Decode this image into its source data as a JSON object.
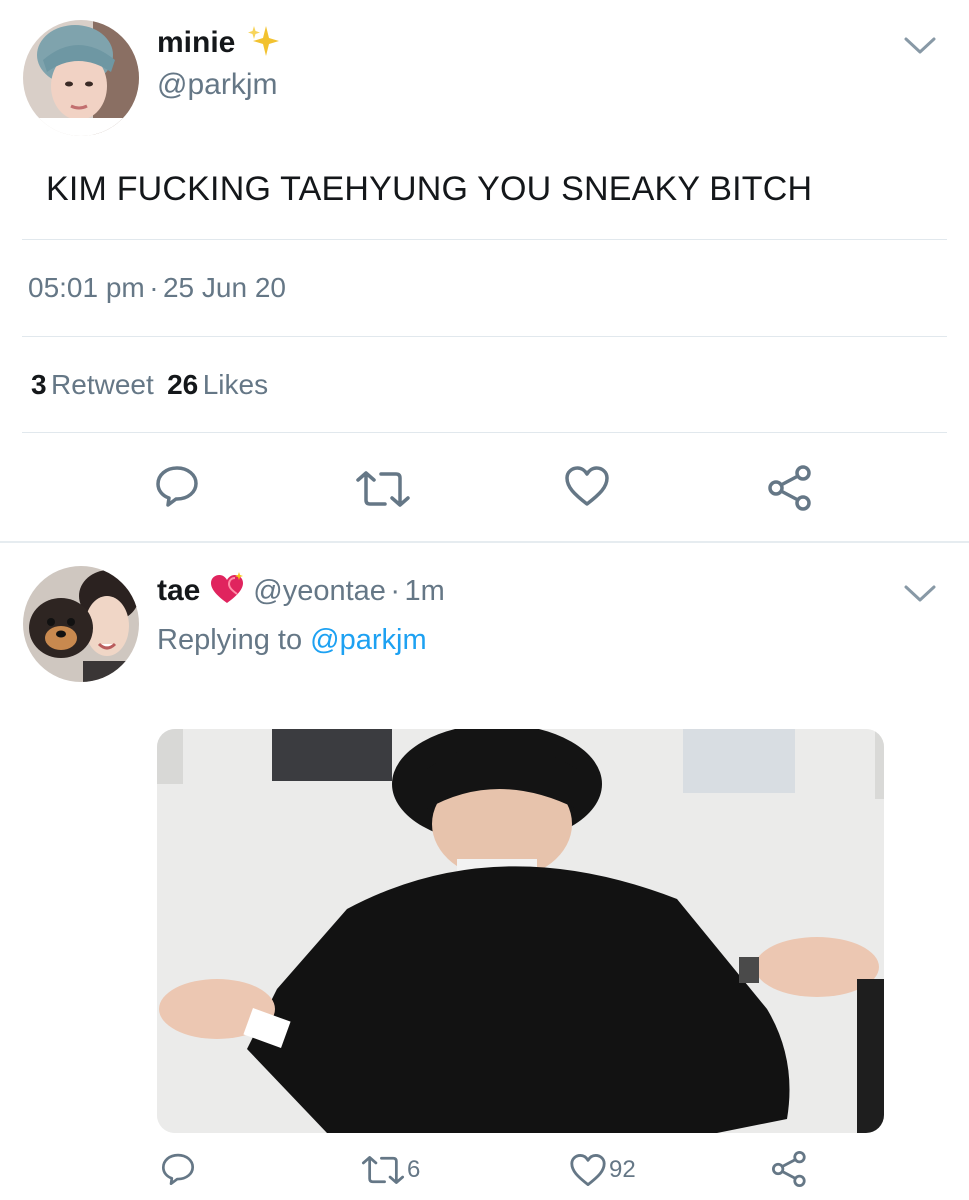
{
  "main_tweet": {
    "display_name": "minie",
    "handle": "@parkjm",
    "text": "KIM FUCKING TAEHYUNG YOU SNEAKY BITCH",
    "time": "05:01 pm",
    "separator": "·",
    "date": "25 Jun 20",
    "retweet_count": "3",
    "retweet_label": "Retweet",
    "likes_count": "26",
    "likes_label": "Likes",
    "icons": [
      "sparkle-icon",
      "chevron-down-icon",
      "reply-icon",
      "retweet-icon",
      "like-icon",
      "share-icon"
    ]
  },
  "reply_tweet": {
    "display_name": "tae",
    "handle": "@yeontae",
    "separator": "·",
    "age": "1m",
    "replying_prefix": "Replying to",
    "replying_to": "@parkjm",
    "retweet_count": "6",
    "like_count": "92",
    "icons": [
      "sparkling-heart-icon",
      "chevron-down-icon",
      "reply-icon",
      "retweet-icon",
      "like-icon",
      "share-icon"
    ]
  },
  "colors": {
    "text_primary": "#14171a",
    "text_secondary": "#657786",
    "link": "#1da1f2",
    "divider": "#e1e8ed",
    "icon": "#657786"
  }
}
